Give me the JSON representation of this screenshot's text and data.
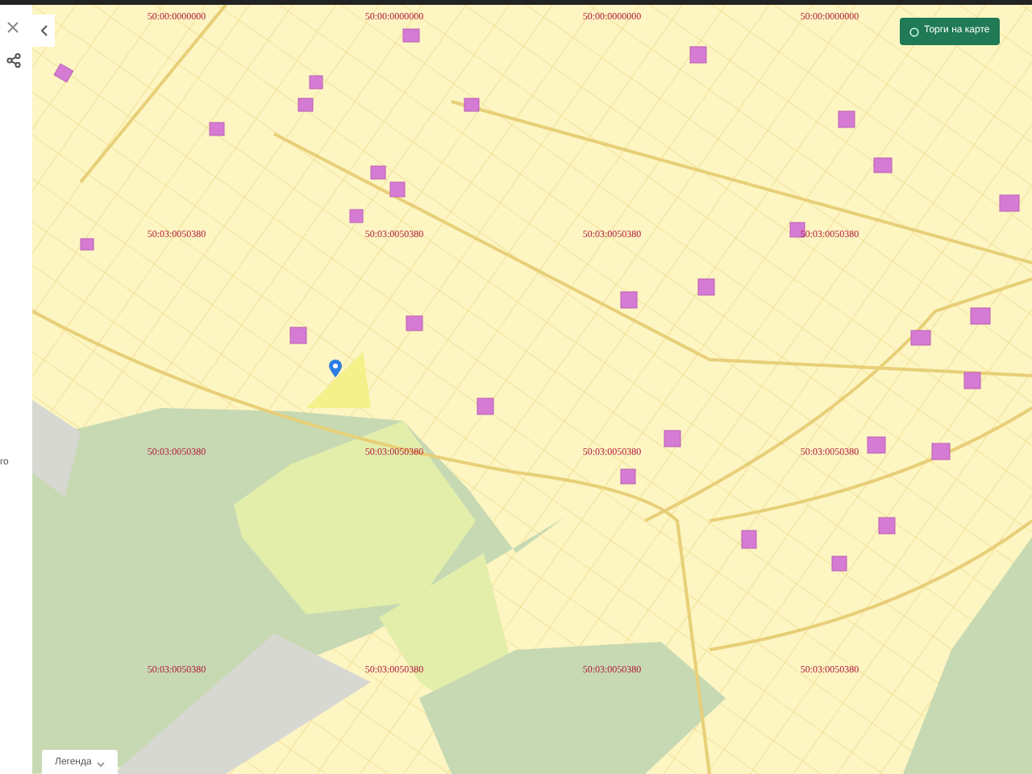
{
  "sidebar": {
    "texts": [
      "го"
    ]
  },
  "map": {
    "label_rows": [
      [
        "50:00:0000000",
        "50:00:0000000",
        "50:00:0000000",
        "50:00:0000000"
      ],
      [
        "50:03:0050380",
        "50:03:0050380",
        "50:03:0050380",
        "50:03:0050380"
      ],
      [
        "50:03:0050380",
        "50:03:0050380",
        "50:03:0050380",
        "50:03:0050380"
      ],
      [
        "50:03:0050380",
        "50:03:0050380",
        "50:03:0050380",
        "50:03:0050380"
      ]
    ]
  },
  "auctions_button": {
    "label": "Торги на карте"
  },
  "legend_button": {
    "label": "Легенда"
  }
}
